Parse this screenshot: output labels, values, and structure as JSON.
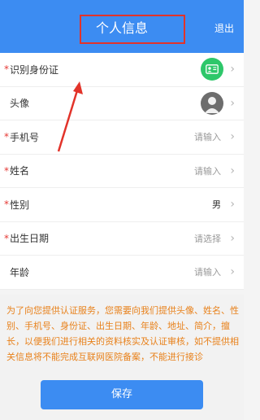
{
  "header": {
    "title": "个人信息",
    "logout_label": "退出",
    "bg_color": "#3c8cf2",
    "annotation_color": "#e2332a"
  },
  "form": {
    "required_mark": "*",
    "rows": [
      {
        "key": "id_card",
        "label": "识别身份证",
        "required": true,
        "icon": "id-card-icon"
      },
      {
        "key": "avatar",
        "label": "头像",
        "required": false,
        "icon": "avatar-icon"
      },
      {
        "key": "phone",
        "label": "手机号",
        "required": true,
        "value": "请输入"
      },
      {
        "key": "name",
        "label": "姓名",
        "required": true,
        "value": "请输入"
      },
      {
        "key": "gender",
        "label": "性别",
        "required": true,
        "value": "男"
      },
      {
        "key": "birth_date",
        "label": "出生日期",
        "required": true,
        "value": "请选择"
      },
      {
        "key": "age",
        "label": "年龄",
        "required": false,
        "value": "请输入"
      }
    ]
  },
  "consent": {
    "text": "为了向您提供认证服务，您需要向我们提供头像、姓名、性别、手机号、身份证、出生日期、年龄、地址、简介，擅长，以便我们进行相关的资料核实及认证审核，如不提供相关信息将不能完成互联网医院备案，不能进行接诊",
    "text_color": "#e8811b"
  },
  "footer": {
    "save_label": "保存"
  }
}
